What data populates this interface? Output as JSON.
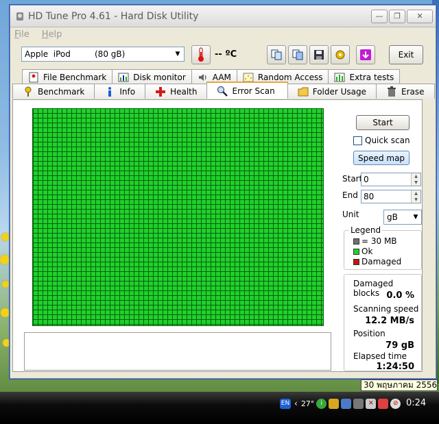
{
  "window": {
    "title": "HD Tune Pro 4.61 - Hard Disk Utility",
    "minimize": "—",
    "maximize": "❐",
    "close": "✕"
  },
  "menu": {
    "file": "File",
    "help": "Help"
  },
  "toolbar": {
    "drive_name": "Apple  iPod",
    "drive_size": "(80 gB)",
    "temperature": "-- ºC",
    "exit_label": "Exit"
  },
  "tabs": {
    "back": [
      "File Benchmark",
      "Disk monitor",
      "AAM",
      "Random Access",
      "Extra tests"
    ],
    "front": [
      "Benchmark",
      "Info",
      "Health",
      "Error Scan",
      "Folder Usage",
      "Erase"
    ],
    "active": "Error Scan"
  },
  "controls": {
    "start_button": "Start",
    "quick_scan": "Quick scan",
    "speed_map": "Speed map",
    "start_label": "Start",
    "start_value": "0",
    "end_label": "End",
    "end_value": "80",
    "unit_label": "Unit",
    "unit_value": "gB"
  },
  "legend": {
    "title": "Legend",
    "block_size": "= 30 MB",
    "ok": "Ok",
    "damaged": "Damaged"
  },
  "stats": {
    "damaged_blocks_label": "Damaged blocks",
    "damaged_blocks_value": "0.0 %",
    "scanning_speed_label": "Scanning speed",
    "scanning_speed_value": "12.2 MB/s",
    "position_label": "Position",
    "position_value": "79 gB",
    "elapsed_label": "Elapsed time",
    "elapsed_value": "1:24:50"
  },
  "colors": {
    "ok": "#1fd12b",
    "damaged": "#cc1111",
    "untested": "#707070",
    "grid_line": "#0b5e0e"
  },
  "tray": {
    "date_tooltip": "30 พฤษภาคม 2556",
    "lang": "EN",
    "temperature": "27°",
    "clock": "0:24"
  }
}
